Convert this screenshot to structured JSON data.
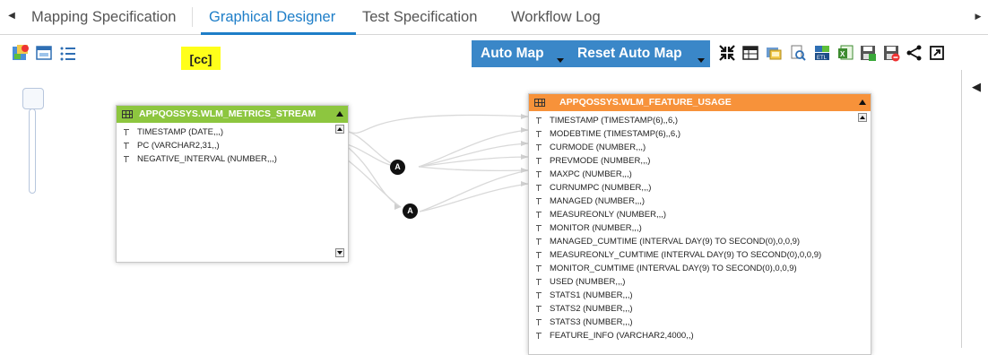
{
  "tabs": {
    "items": [
      {
        "label": "Mapping Specification"
      },
      {
        "label": "Graphical Designer",
        "active": true
      },
      {
        "label": "Test Specification"
      },
      {
        "label": "Workflow Log"
      }
    ]
  },
  "toolbar": {
    "tag_label": "[cc]",
    "auto_map_label": "Auto Map",
    "reset_auto_map_label": "Reset Auto Map",
    "left_icons": [
      "color-palette-icon",
      "window-icon",
      "list-icon"
    ],
    "right_icons": [
      "collapse-arrows-icon",
      "table-view-icon",
      "export-image-icon",
      "search-document-icon",
      "etl-icon",
      "excel-export-icon",
      "save-icon",
      "save-delete-icon",
      "share-icon",
      "expand-icon"
    ]
  },
  "source_table": {
    "title": "APPQOSSYS.WLM_METRICS_STREAM",
    "header_color": "#8dc63f",
    "columns": [
      "TIMESTAMP (DATE,,,)",
      "PC (VARCHAR2,31,,)",
      "NEGATIVE_INTERVAL (NUMBER,,,)"
    ]
  },
  "target_table": {
    "title": "APPQOSSYS.WLM_FEATURE_USAGE",
    "header_color": "#f7923a",
    "columns": [
      "TIMESTAMP (TIMESTAMP(6),,6,)",
      "MODEBTIME (TIMESTAMP(6),,6,)",
      "CURMODE (NUMBER,,,)",
      "PREVMODE (NUMBER,,,)",
      "MAXPC (NUMBER,,,)",
      "CURNUMPC (NUMBER,,,)",
      "MANAGED (NUMBER,,,)",
      "MEASUREONLY (NUMBER,,,)",
      "MONITOR (NUMBER,,,)",
      "MANAGED_CUMTIME (INTERVAL DAY(9) TO SECOND(0),0,0,9)",
      "MEASUREONLY_CUMTIME (INTERVAL DAY(9) TO SECOND(0),0,0,9)",
      "MONITOR_CUMTIME (INTERVAL DAY(9) TO SECOND(0),0,0,9)",
      "USED (NUMBER,,,)",
      "STATS1 (NUMBER,,,)",
      "STATS2 (NUMBER,,,)",
      "STATS3 (NUMBER,,,)",
      "FEATURE_INFO (VARCHAR2,4000,,)"
    ]
  },
  "mapping_nodes": [
    {
      "label": "A"
    },
    {
      "label": "A"
    }
  ],
  "colors": {
    "accent": "#1e7ec8",
    "button_blue": "#3a87c8",
    "tag_yellow": "#ffff1a"
  }
}
